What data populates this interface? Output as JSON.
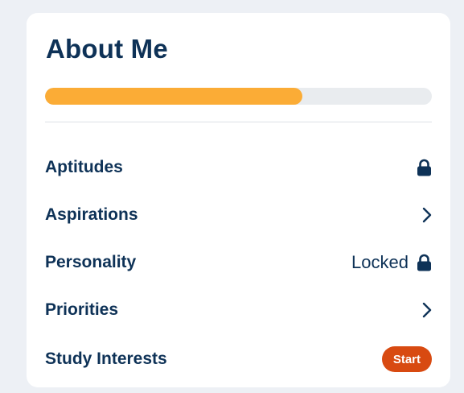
{
  "card": {
    "title": "About Me",
    "progress_fraction": 0.665
  },
  "items": [
    {
      "label": "Aptitudes",
      "status_text": "",
      "indicator": "lock-icon"
    },
    {
      "label": "Aspirations",
      "status_text": "",
      "indicator": "chevron-right-icon"
    },
    {
      "label": "Personality",
      "status_text": "Locked",
      "indicator": "lock-icon"
    },
    {
      "label": "Priorities",
      "status_text": "",
      "indicator": "chevron-right-icon"
    },
    {
      "label": "Study Interests",
      "badge": "Start",
      "indicator": "start-badge"
    }
  ],
  "colors": {
    "text": "#0e3257",
    "progress": "#fbac36",
    "track": "#e9ecef",
    "start_badge": "#d84a11"
  }
}
